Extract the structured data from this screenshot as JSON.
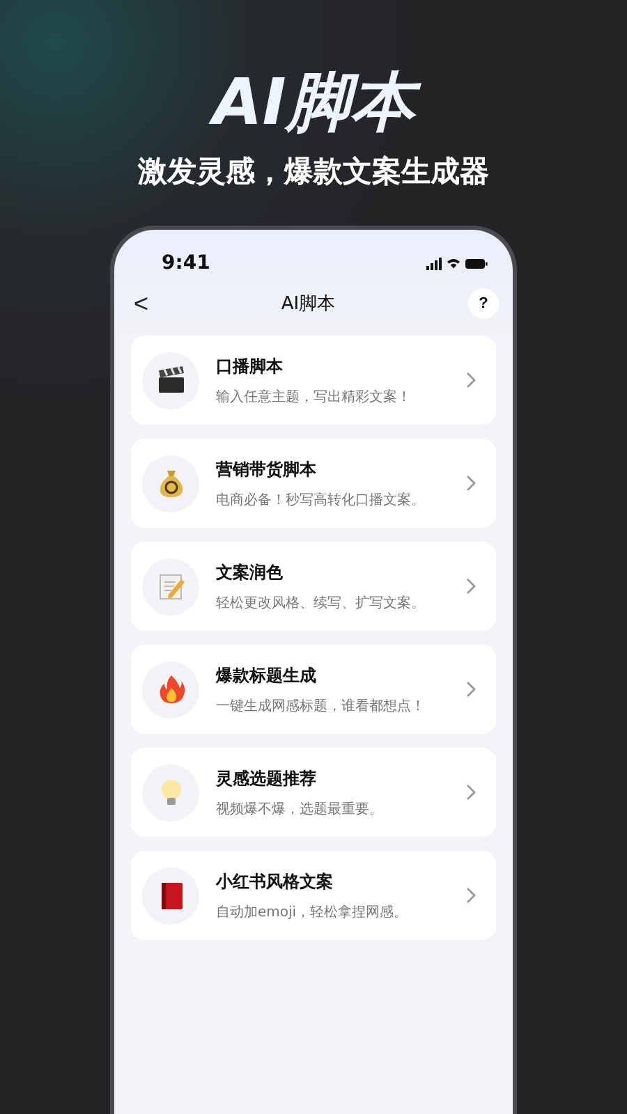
{
  "headline": "AI脚本",
  "tagline": "激发灵感，爆款文案生成器",
  "status_bar": {
    "time": "9:41"
  },
  "nav": {
    "back": "<",
    "title": "AI脚本",
    "help": "?"
  },
  "items": [
    {
      "kind": "clapper",
      "title": "口播脚本",
      "subtitle": "输入任意主题，写出精彩文案！"
    },
    {
      "kind": "moneybag",
      "title": "营销带货脚本",
      "subtitle": "电商必备！秒写高转化口播文案。"
    },
    {
      "kind": "memo",
      "title": "文案润色",
      "subtitle": "轻松更改风格、续写、扩写文案。"
    },
    {
      "kind": "fire",
      "title": "爆款标题生成",
      "subtitle": "一键生成网感标题，谁看都想点！"
    },
    {
      "kind": "bulb",
      "title": "灵感选题推荐",
      "subtitle": "视频爆不爆，选题最重要。"
    },
    {
      "kind": "book",
      "title": "小红书风格文案",
      "subtitle": "自动加emoji，轻松拿捏网感。"
    }
  ]
}
